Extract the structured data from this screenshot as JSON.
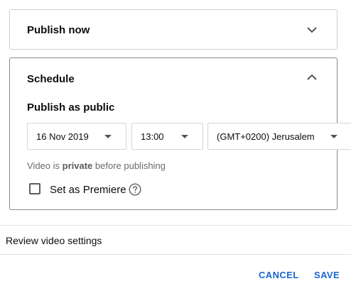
{
  "publish_now": {
    "title": "Publish now",
    "expanded": false
  },
  "schedule": {
    "title": "Schedule",
    "expanded": true,
    "subtitle": "Publish as public",
    "date": "16 Nov 2019",
    "time": "13:00",
    "timezone": "(GMT+0200) Jerusalem",
    "note_prefix": "Video is ",
    "note_bold": "private",
    "note_suffix": " before publishing",
    "premiere_label": "Set as Premiere",
    "premiere_checked": false
  },
  "review_label": "Review video settings",
  "actions": {
    "cancel_label": "CANCEL",
    "save_label": "SAVE"
  },
  "colors": {
    "accent": "#1a66d0",
    "border": "#cfcfcf",
    "muted_text": "#6b6b6b"
  }
}
